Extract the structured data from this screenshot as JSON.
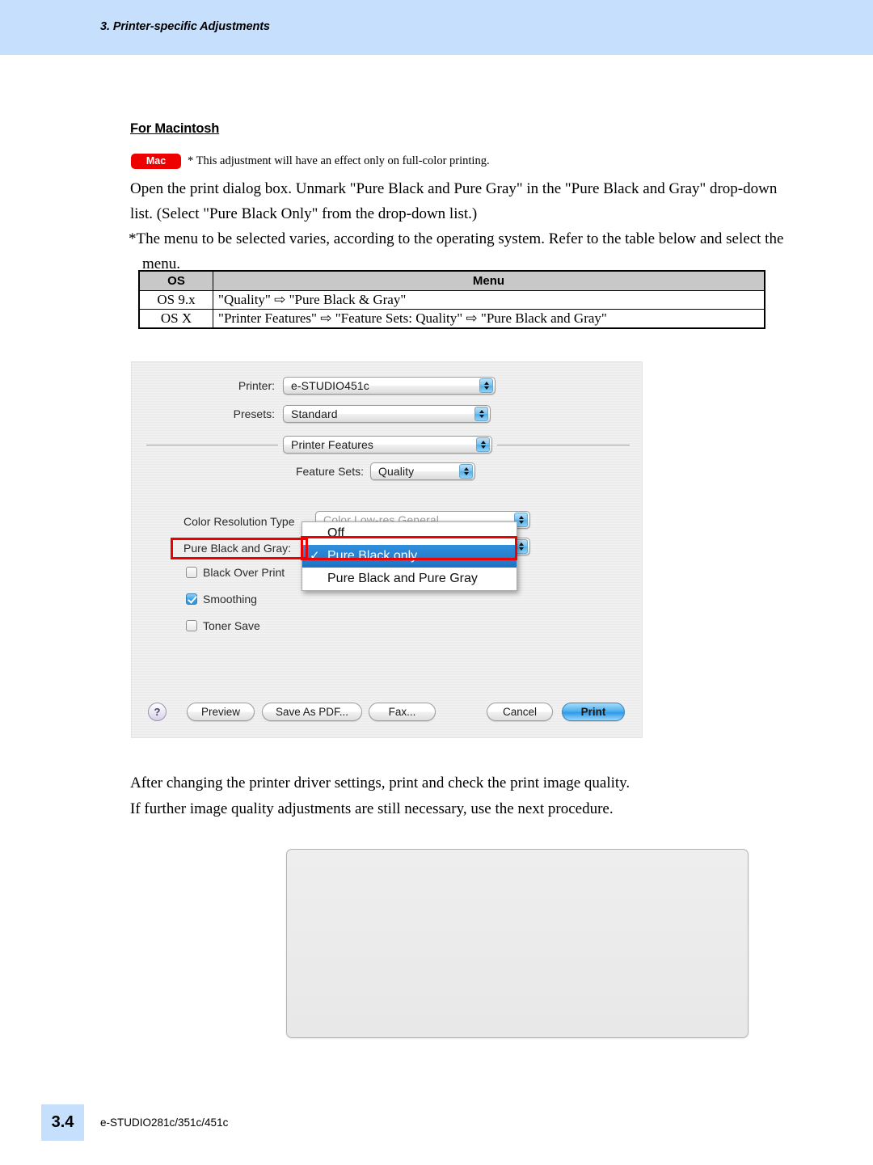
{
  "header": {
    "title": "3. Printer-specific Adjustments"
  },
  "section": {
    "heading": "For Macintosh",
    "badge": "Mac",
    "badge_note": "* This adjustment will have an effect only on full-color printing.",
    "paragraph_1": "Open the print dialog box.  Unmark \"Pure Black and Pure Gray\" in the \"Pure Black and Gray\" drop-down",
    "paragraph_2": "list. (Select \"Pure Black Only\" from the drop-down list.)",
    "note_line_1": "*The menu to be selected varies, according to the operating system. Refer to the table below and select the",
    "note_line_2": "menu."
  },
  "os_table": {
    "headers": [
      "OS",
      "Menu"
    ],
    "rows": [
      {
        "os": "OS 9.x",
        "menu": "\"Quality\" ⇨ \"Pure Black & Gray\""
      },
      {
        "os": "OS X",
        "menu": "\"Printer Features\" ⇨ \"Feature Sets: Quality\" ⇨ \"Pure Black and  Gray\""
      }
    ]
  },
  "dialog": {
    "printer_label": "Printer:",
    "printer_value": "e-STUDIO451c",
    "presets_label": "Presets:",
    "presets_value": "Standard",
    "pane_value": "Printer Features",
    "feature_sets_label": "Feature Sets:",
    "feature_sets_value": "Quality",
    "color_resolution_label": "Color Resolution Type",
    "color_resolution_value": "Color Low-res General",
    "pure_black_label": "Pure Black and Gray:",
    "checkboxes": [
      {
        "label": "Black Over Print",
        "checked": false
      },
      {
        "label": "Smoothing",
        "checked": true
      },
      {
        "label": "Toner Save",
        "checked": false
      }
    ],
    "dropdown_items": [
      {
        "label": "Off",
        "selected": false,
        "check": ""
      },
      {
        "label": "Pure Black only",
        "selected": true,
        "check": "✓"
      },
      {
        "label": "Pure Black and Pure Gray",
        "selected": false,
        "check": ""
      }
    ],
    "buttons": {
      "help": "?",
      "preview": "Preview",
      "save_as_pdf": "Save As PDF...",
      "fax": "Fax...",
      "cancel": "Cancel",
      "print": "Print"
    }
  },
  "closing": {
    "line_1": "After changing the printer driver settings, print and check the print image quality.",
    "line_2": "If further image quality adjustments are still necessary, use the next procedure."
  },
  "footer": {
    "page_number": "3.4",
    "model": "e-STUDIO281c/351c/451c"
  },
  "colors": {
    "header_band": "#c6dffc",
    "badge_red": "#ee0000",
    "annotation_red": "#ee0000",
    "selection_blue": "#2f8fdc",
    "table_header_gray": "#c8c8c8"
  }
}
